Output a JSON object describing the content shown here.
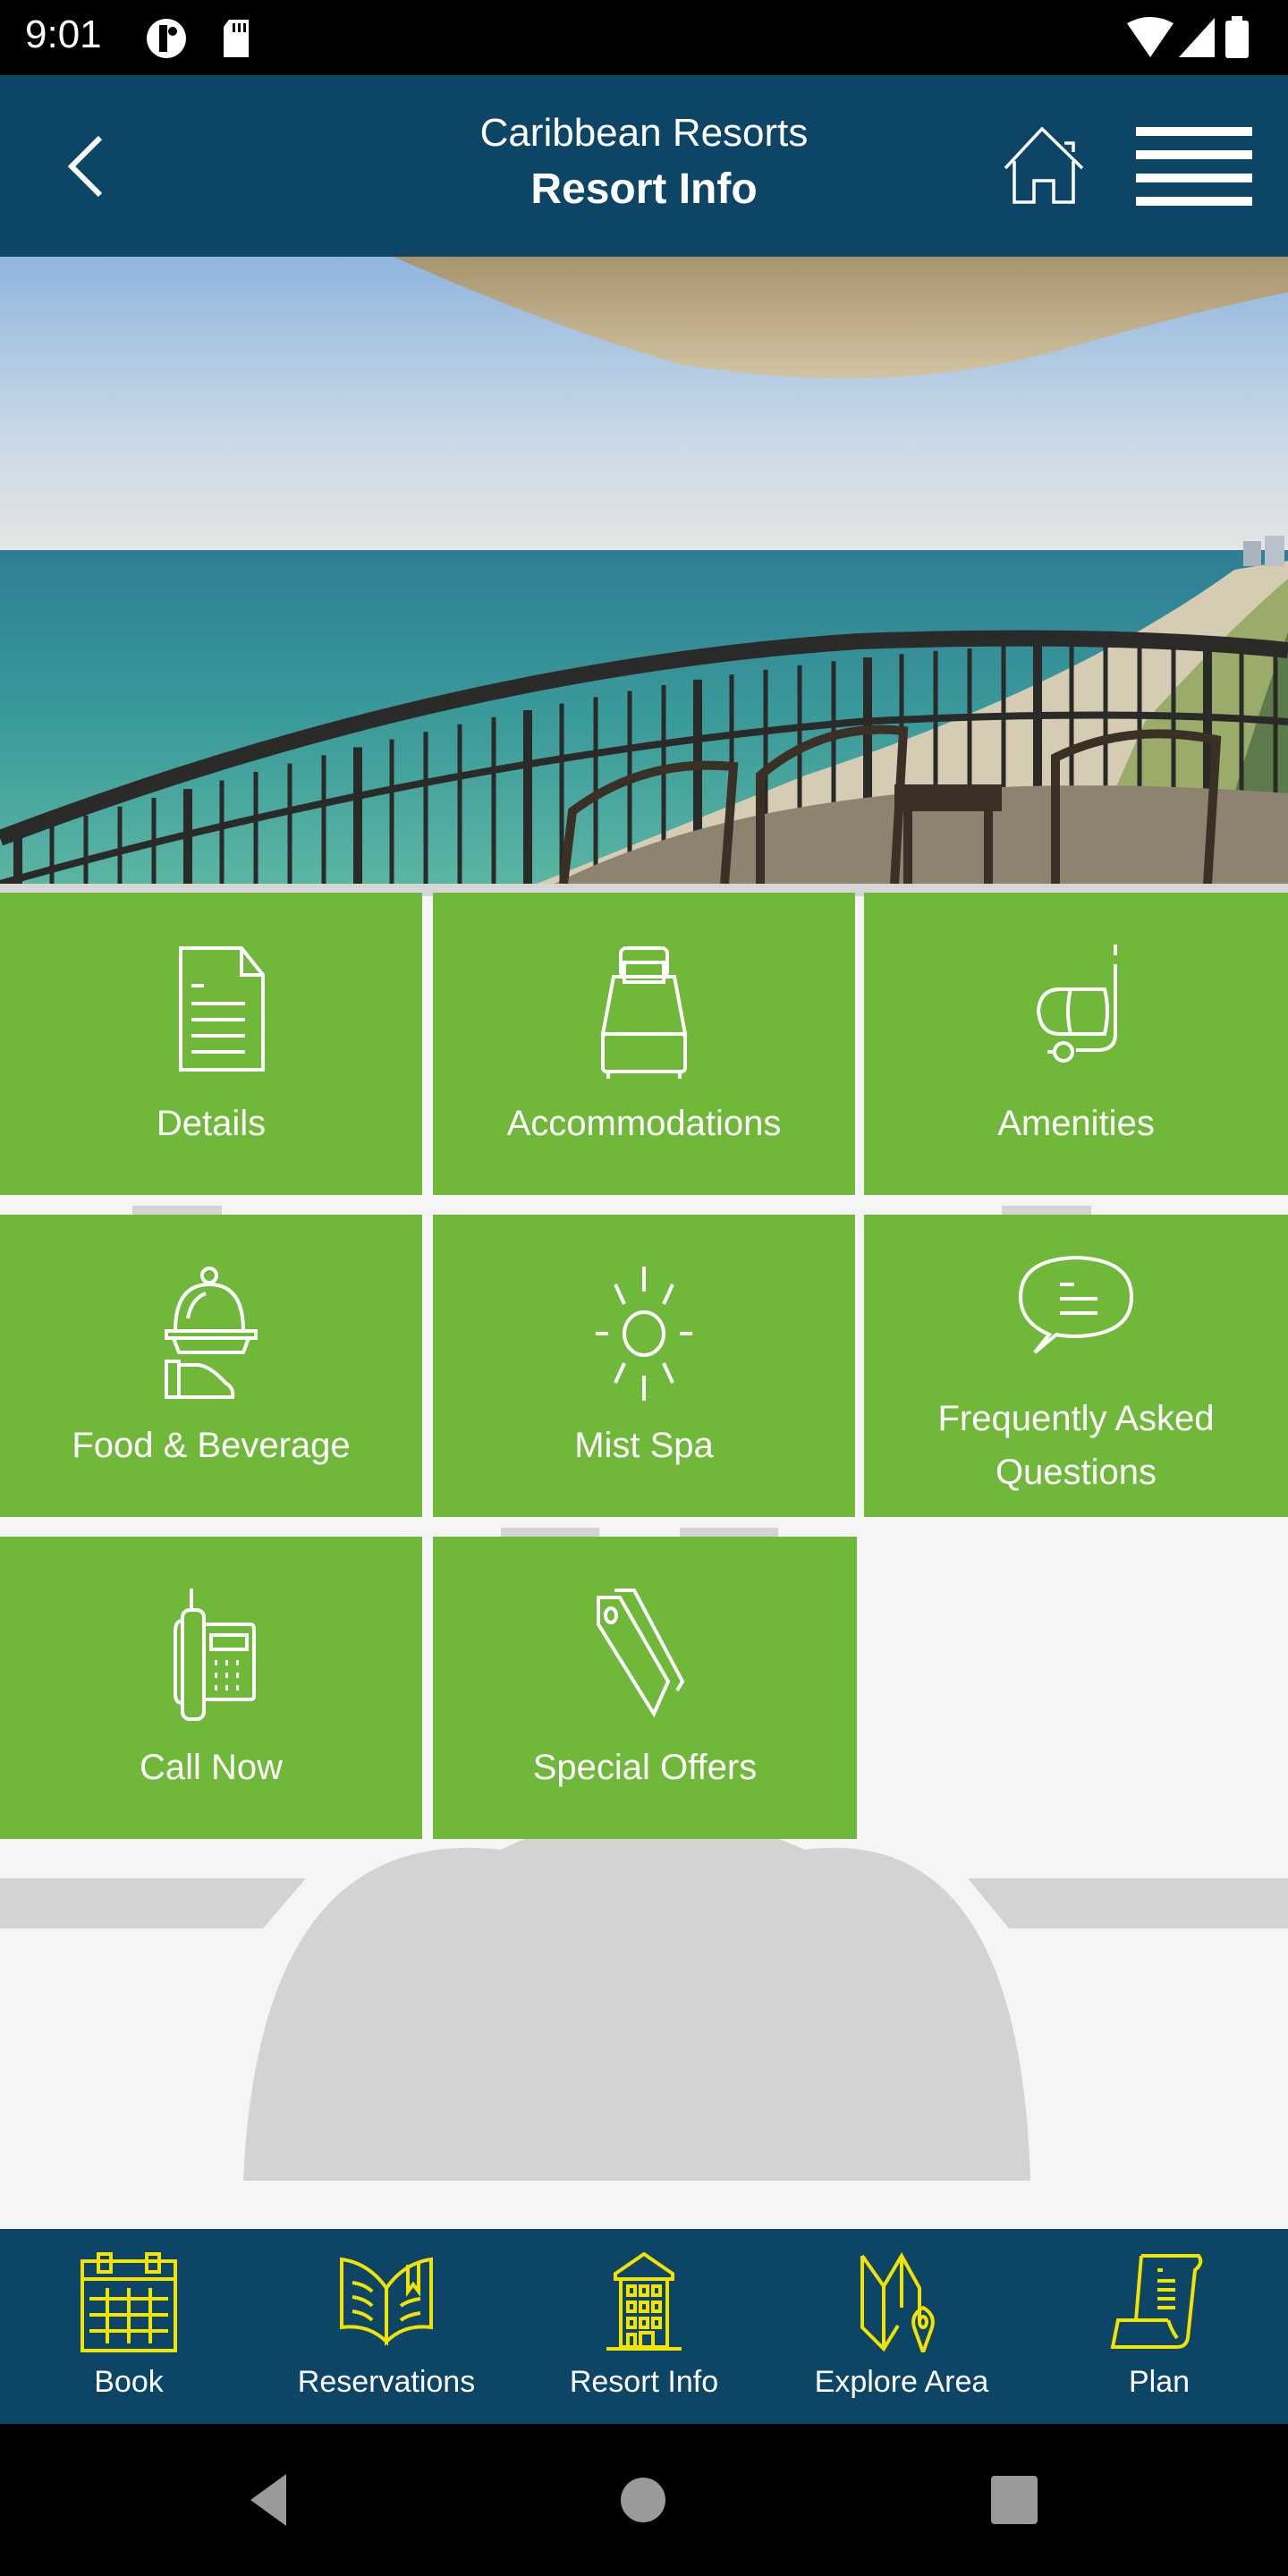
{
  "status_bar": {
    "time": "9:01",
    "icons": [
      "app-notification-icon",
      "sd-card-icon",
      "wifi-icon",
      "cell-signal-icon",
      "battery-icon"
    ]
  },
  "header": {
    "subtitle": "Caribbean Resorts",
    "title": "Resort Info",
    "back_icon": "chevron-left-icon",
    "home_icon": "home-icon",
    "menu_icon": "hamburger-menu-icon"
  },
  "hero": {
    "description": "Balcony view overlooking ocean and beach"
  },
  "tiles": [
    {
      "label": "Details",
      "icon": "document-icon"
    },
    {
      "label": "Accommodations",
      "icon": "bed-icon"
    },
    {
      "label": "Amenities",
      "icon": "snorkel-mask-icon"
    },
    {
      "label": "Food & Beverage",
      "icon": "serving-cloche-icon"
    },
    {
      "label": "Mist Spa",
      "icon": "sun-icon"
    },
    {
      "label": "Frequently Asked Questions",
      "label_line1": "Frequently Asked",
      "label_line2": "Questions",
      "icon": "speech-bubble-icon"
    },
    {
      "label": "Call Now",
      "icon": "telephone-icon"
    },
    {
      "label": "Special Offers",
      "icon": "price-tag-icon"
    }
  ],
  "bottom_nav": [
    {
      "label": "Book",
      "icon": "calendar-icon"
    },
    {
      "label": "Reservations",
      "icon": "open-book-icon"
    },
    {
      "label": "Resort Info",
      "icon": "building-icon"
    },
    {
      "label": "Explore Area",
      "icon": "map-pin-icon"
    },
    {
      "label": "Plan",
      "icon": "scroll-icon"
    }
  ],
  "colors": {
    "header_bg": "#0d4566",
    "tile_green": "#6fb83a",
    "nav_icon_yellow": "#f2e200",
    "background": "#f5f5f5",
    "placeholder_gray": "#d3d3d3"
  }
}
